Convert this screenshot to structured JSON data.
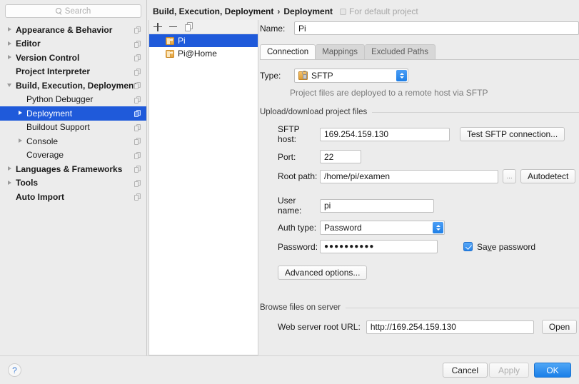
{
  "search": {
    "placeholder": "Search",
    "icon": "search-icon"
  },
  "sidebar": {
    "items": [
      {
        "label": "Appearance & Behavior",
        "bold": true,
        "indent": 0,
        "arrow": "collapsed",
        "selected": false
      },
      {
        "label": "Editor",
        "bold": true,
        "indent": 0,
        "arrow": "collapsed",
        "selected": false
      },
      {
        "label": "Version Control",
        "bold": true,
        "indent": 0,
        "arrow": "collapsed",
        "selected": false
      },
      {
        "label": "Project Interpreter",
        "bold": true,
        "indent": 0,
        "arrow": "none",
        "selected": false
      },
      {
        "label": "Build, Execution, Deployment",
        "bold": true,
        "indent": 0,
        "arrow": "expanded",
        "selected": false
      },
      {
        "label": "Python Debugger",
        "bold": false,
        "indent": 1,
        "arrow": "none",
        "selected": false
      },
      {
        "label": "Deployment",
        "bold": false,
        "indent": 1,
        "arrow": "collapsed",
        "selected": true
      },
      {
        "label": "Buildout Support",
        "bold": false,
        "indent": 1,
        "arrow": "none",
        "selected": false
      },
      {
        "label": "Console",
        "bold": false,
        "indent": 1,
        "arrow": "collapsed",
        "selected": false
      },
      {
        "label": "Coverage",
        "bold": false,
        "indent": 1,
        "arrow": "none",
        "selected": false
      },
      {
        "label": "Languages & Frameworks",
        "bold": true,
        "indent": 0,
        "arrow": "collapsed",
        "selected": false
      },
      {
        "label": "Tools",
        "bold": true,
        "indent": 0,
        "arrow": "collapsed",
        "selected": false
      },
      {
        "label": "Auto Import",
        "bold": true,
        "indent": 0,
        "arrow": "none",
        "selected": false
      }
    ]
  },
  "breadcrumb": {
    "parent": "Build, Execution, Deployment",
    "separator": "›",
    "current": "Deployment",
    "scope": "For default project"
  },
  "server_list": {
    "toolbar": [
      {
        "name": "add-server-button",
        "icon": "plus-icon"
      },
      {
        "name": "remove-server-button",
        "icon": "minus-icon"
      },
      {
        "name": "duplicate-server-button",
        "icon": "copy-icon"
      }
    ],
    "items": [
      {
        "label": "Pi",
        "selected": true
      },
      {
        "label": "Pi@Home",
        "selected": false
      }
    ]
  },
  "form": {
    "name_label": "Name:",
    "name_value": "Pi",
    "tabs": [
      {
        "label": "Connection",
        "active": true
      },
      {
        "label": "Mappings",
        "active": false
      },
      {
        "label": "Excluded Paths",
        "active": false
      }
    ],
    "type_label": "Type:",
    "type_value": "SFTP",
    "type_hint": "Project files are deployed to a remote host via SFTP",
    "upload_group": "Upload/download project files",
    "sftp_host_label": "SFTP host:",
    "sftp_host_value": "169.254.159.130",
    "test_connection_label": "Test SFTP connection...",
    "port_label": "Port:",
    "port_value": "22",
    "root_path_label": "Root path:",
    "root_path_value": "/home/pi/examen",
    "browse_label": "...",
    "autodetect_label": "Autodetect",
    "user_name_label": "User name:",
    "user_name_value": "pi",
    "auth_type_label": "Auth type:",
    "auth_type_value": "Password",
    "password_label": "Password:",
    "password_value": "●●●●●●●●●●",
    "save_password_label_pre": "Sa",
    "save_password_label_mnemonic": "v",
    "save_password_label_post": "e password",
    "save_password_checked": true,
    "advanced_label": "Advanced options...",
    "browse_group": "Browse files on server",
    "web_url_label": "Web server root URL:",
    "web_url_value": "http://169.254.159.130",
    "open_label": "Open"
  },
  "footer": {
    "help_label": "?",
    "cancel_label": "Cancel",
    "apply_label": "Apply",
    "apply_enabled": false,
    "ok_label": "OK"
  },
  "colors": {
    "selection_blue": "#1f5ada",
    "ok_blue": "#1a7fe8",
    "window_bg": "#ececec",
    "panel_white": "#ffffff"
  }
}
